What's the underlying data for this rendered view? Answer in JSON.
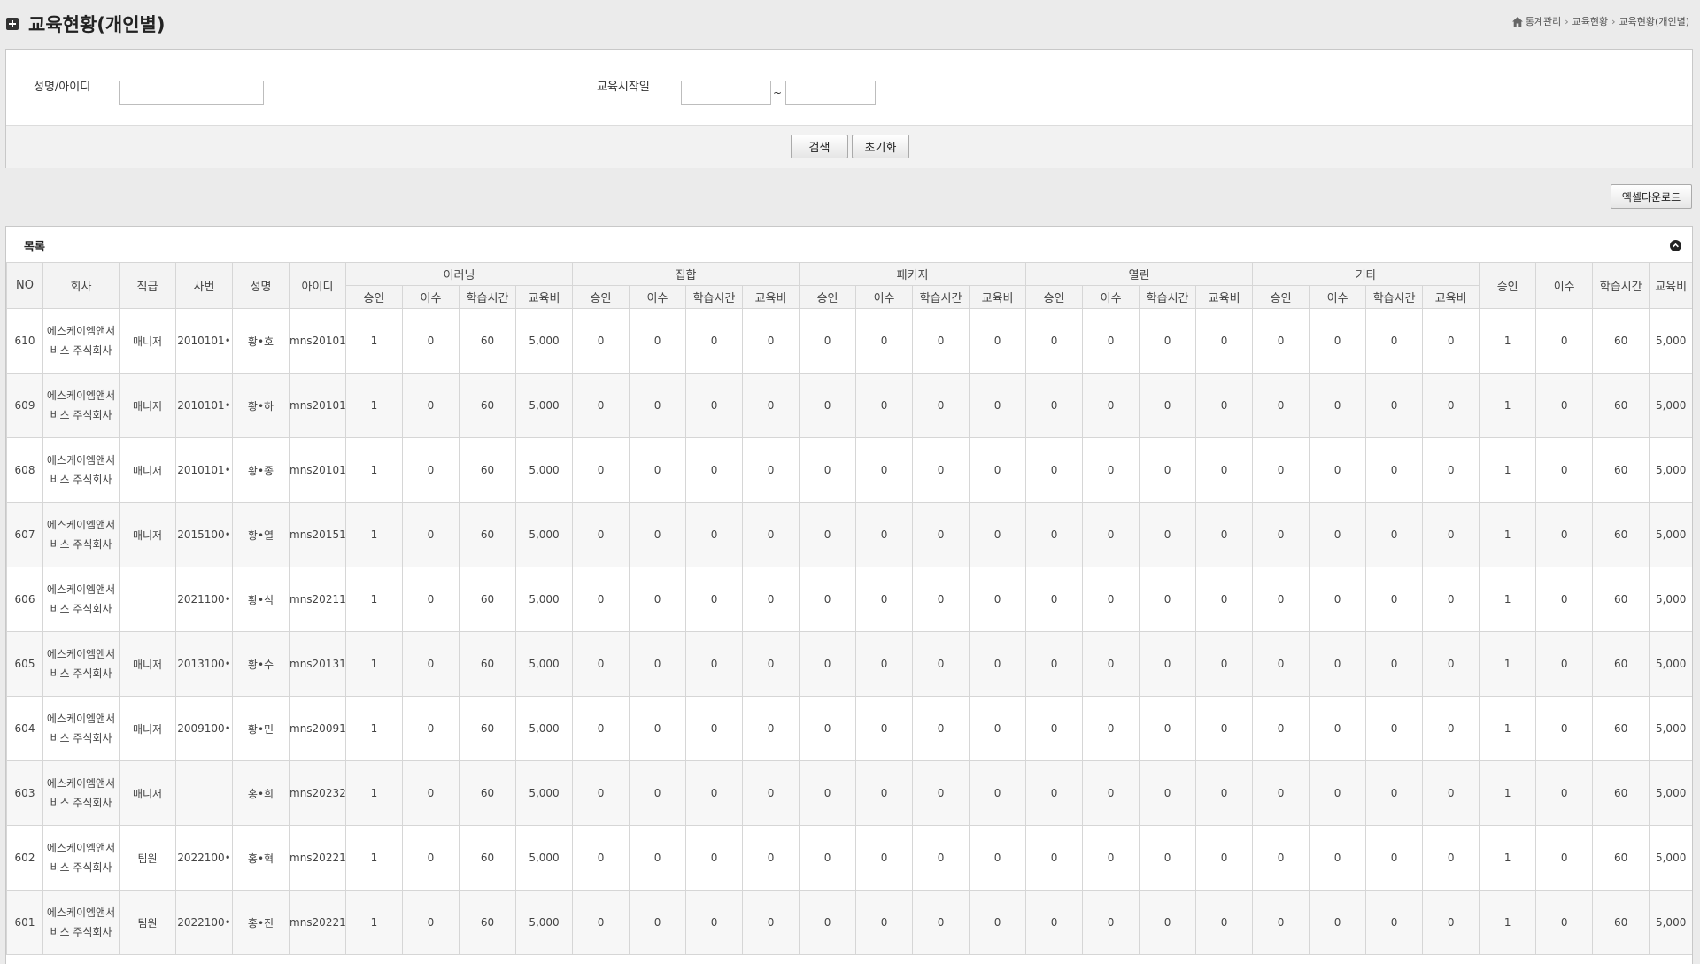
{
  "header": {
    "title": "교육현황(개인별)",
    "breadcrumb": [
      "통계관리",
      "교육현황",
      "교육현황(개인별)"
    ]
  },
  "search": {
    "name_label": "성명/아이디",
    "name_value": "",
    "date_label": "교육시작일",
    "date_from": "",
    "date_to": "",
    "date_sep": "~",
    "search_button": "검색",
    "reset_button": "초기화"
  },
  "excel_button": "엑셀다운로드",
  "list": {
    "title": "목록",
    "fixed_headers": [
      "NO",
      "회사",
      "직급",
      "사번",
      "성명",
      "아이디"
    ],
    "groups": [
      "이러닝",
      "집합",
      "패키지",
      "열린",
      "기타"
    ],
    "sub_headers": [
      "승인",
      "이수",
      "학습시간",
      "교육비"
    ],
    "rows": [
      {
        "no": "610",
        "company": "에스케이엠앤서비스 주식회사",
        "position": "매니저",
        "emp_no": "2010101•",
        "name": "황•호",
        "id": "mns20101",
        "values": [
          "1",
          "0",
          "60",
          "5,000",
          "0",
          "0",
          "0",
          "0",
          "0",
          "0",
          "0",
          "0",
          "0",
          "0",
          "0",
          "0",
          "0",
          "0",
          "0",
          "0",
          "1",
          "0",
          "60",
          "5,000"
        ]
      },
      {
        "no": "609",
        "company": "에스케이엠앤서비스 주식회사",
        "position": "매니저",
        "emp_no": "2010101•",
        "name": "황•하",
        "id": "mns20101",
        "values": [
          "1",
          "0",
          "60",
          "5,000",
          "0",
          "0",
          "0",
          "0",
          "0",
          "0",
          "0",
          "0",
          "0",
          "0",
          "0",
          "0",
          "0",
          "0",
          "0",
          "0",
          "1",
          "0",
          "60",
          "5,000"
        ]
      },
      {
        "no": "608",
        "company": "에스케이엠앤서비스 주식회사",
        "position": "매니저",
        "emp_no": "2010101•",
        "name": "황•종",
        "id": "mns20101",
        "values": [
          "1",
          "0",
          "60",
          "5,000",
          "0",
          "0",
          "0",
          "0",
          "0",
          "0",
          "0",
          "0",
          "0",
          "0",
          "0",
          "0",
          "0",
          "0",
          "0",
          "0",
          "1",
          "0",
          "60",
          "5,000"
        ]
      },
      {
        "no": "607",
        "company": "에스케이엠앤서비스 주식회사",
        "position": "매니저",
        "emp_no": "2015100•",
        "name": "황•열",
        "id": "mns20151",
        "values": [
          "1",
          "0",
          "60",
          "5,000",
          "0",
          "0",
          "0",
          "0",
          "0",
          "0",
          "0",
          "0",
          "0",
          "0",
          "0",
          "0",
          "0",
          "0",
          "0",
          "0",
          "1",
          "0",
          "60",
          "5,000"
        ]
      },
      {
        "no": "606",
        "company": "에스케이엠앤서비스 주식회사",
        "position": "",
        "emp_no": "2021100•",
        "name": "황•식",
        "id": "mns20211",
        "values": [
          "1",
          "0",
          "60",
          "5,000",
          "0",
          "0",
          "0",
          "0",
          "0",
          "0",
          "0",
          "0",
          "0",
          "0",
          "0",
          "0",
          "0",
          "0",
          "0",
          "0",
          "1",
          "0",
          "60",
          "5,000"
        ]
      },
      {
        "no": "605",
        "company": "에스케이엠앤서비스 주식회사",
        "position": "매니저",
        "emp_no": "2013100•",
        "name": "황•수",
        "id": "mns20131",
        "values": [
          "1",
          "0",
          "60",
          "5,000",
          "0",
          "0",
          "0",
          "0",
          "0",
          "0",
          "0",
          "0",
          "0",
          "0",
          "0",
          "0",
          "0",
          "0",
          "0",
          "0",
          "1",
          "0",
          "60",
          "5,000"
        ]
      },
      {
        "no": "604",
        "company": "에스케이엠앤서비스 주식회사",
        "position": "매니저",
        "emp_no": "2009100•",
        "name": "황•민",
        "id": "mns20091",
        "values": [
          "1",
          "0",
          "60",
          "5,000",
          "0",
          "0",
          "0",
          "0",
          "0",
          "0",
          "0",
          "0",
          "0",
          "0",
          "0",
          "0",
          "0",
          "0",
          "0",
          "0",
          "1",
          "0",
          "60",
          "5,000"
        ]
      },
      {
        "no": "603",
        "company": "에스케이엠앤서비스 주식회사",
        "position": "매니저",
        "emp_no": "",
        "name": "홍•희",
        "id": "mns20232",
        "values": [
          "1",
          "0",
          "60",
          "5,000",
          "0",
          "0",
          "0",
          "0",
          "0",
          "0",
          "0",
          "0",
          "0",
          "0",
          "0",
          "0",
          "0",
          "0",
          "0",
          "0",
          "1",
          "0",
          "60",
          "5,000"
        ]
      },
      {
        "no": "602",
        "company": "에스케이엠앤서비스 주식회사",
        "position": "팀원",
        "emp_no": "2022100•",
        "name": "홍•혁",
        "id": "mns20221",
        "values": [
          "1",
          "0",
          "60",
          "5,000",
          "0",
          "0",
          "0",
          "0",
          "0",
          "0",
          "0",
          "0",
          "0",
          "0",
          "0",
          "0",
          "0",
          "0",
          "0",
          "0",
          "1",
          "0",
          "60",
          "5,000"
        ]
      },
      {
        "no": "601",
        "company": "에스케이엠앤서비스 주식회사",
        "position": "팀원",
        "emp_no": "2022100•",
        "name": "홍•진",
        "id": "mns20221",
        "values": [
          "1",
          "0",
          "60",
          "5,000",
          "0",
          "0",
          "0",
          "0",
          "0",
          "0",
          "0",
          "0",
          "0",
          "0",
          "0",
          "0",
          "0",
          "0",
          "0",
          "0",
          "1",
          "0",
          "60",
          "5,000"
        ]
      }
    ]
  },
  "icons": {
    "title": "plus-square-icon",
    "breadcrumb": "home-icon",
    "collapse": "circle-chevron-up-icon"
  },
  "colors": {
    "page_bg": "#ebebeb",
    "header_bg": "#f3f3f3",
    "border": "#d6d6d6"
  }
}
